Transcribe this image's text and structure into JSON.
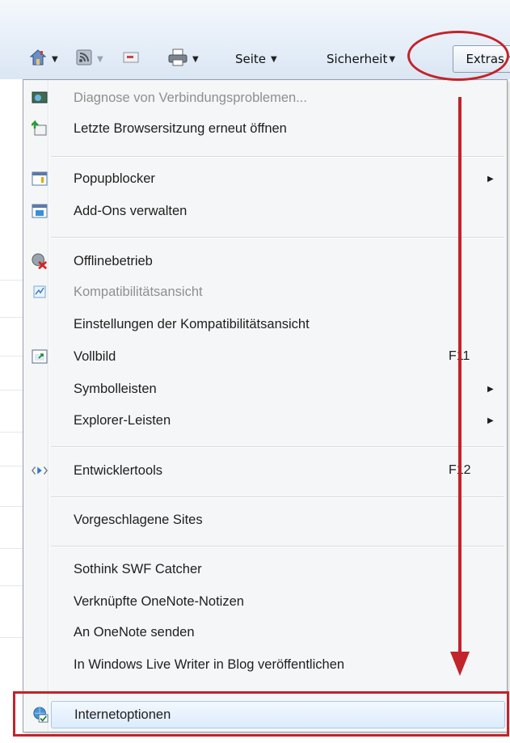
{
  "toolbar": {
    "home_icon": "home-icon",
    "feeds_icon": "rss-feeds-icon",
    "mail_icon": "mail-icon",
    "print_icon": "printer-icon",
    "page_label": "Seite",
    "safety_label": "Sicherheit",
    "extras_label": "Extras"
  },
  "menu": {
    "items": [
      {
        "label": "Diagnose von Verbindungsproblemen...",
        "icon": "network-diagnose-icon",
        "disabled": true
      },
      {
        "label": "Letzte Browsersitzung erneut öffnen",
        "icon": "reopen-session-icon"
      },
      {
        "label": "Popupblocker",
        "icon": "popup-blocker-icon",
        "submenu": true
      },
      {
        "label": "Add-Ons verwalten",
        "icon": "addons-icon"
      },
      {
        "label": "Offlinebetrieb",
        "icon": "offline-icon"
      },
      {
        "label": "Kompatibilitätsansicht",
        "icon": "compat-view-icon",
        "disabled": true
      },
      {
        "label": "Einstellungen der Kompatibilitätsansicht"
      },
      {
        "label": "Vollbild",
        "icon": "fullscreen-icon",
        "accel": "F11"
      },
      {
        "label": "Symbolleisten",
        "submenu": true
      },
      {
        "label": "Explorer-Leisten",
        "submenu": true
      },
      {
        "label": "Entwicklertools",
        "icon": "developer-tools-icon",
        "accel": "F12"
      },
      {
        "label": "Vorgeschlagene Sites"
      },
      {
        "label": "Sothink SWF Catcher"
      },
      {
        "label": "Verknüpfte OneNote-Notizen"
      },
      {
        "label": "An OneNote senden"
      },
      {
        "label": "In Windows Live Writer in Blog veröffentlichen"
      },
      {
        "label": "Internetoptionen",
        "icon": "internet-options-icon"
      }
    ]
  },
  "colors": {
    "annotation": "#c3232a",
    "highlight_border": "#a8c8ea",
    "disabled_text": "#8f8f8f"
  }
}
